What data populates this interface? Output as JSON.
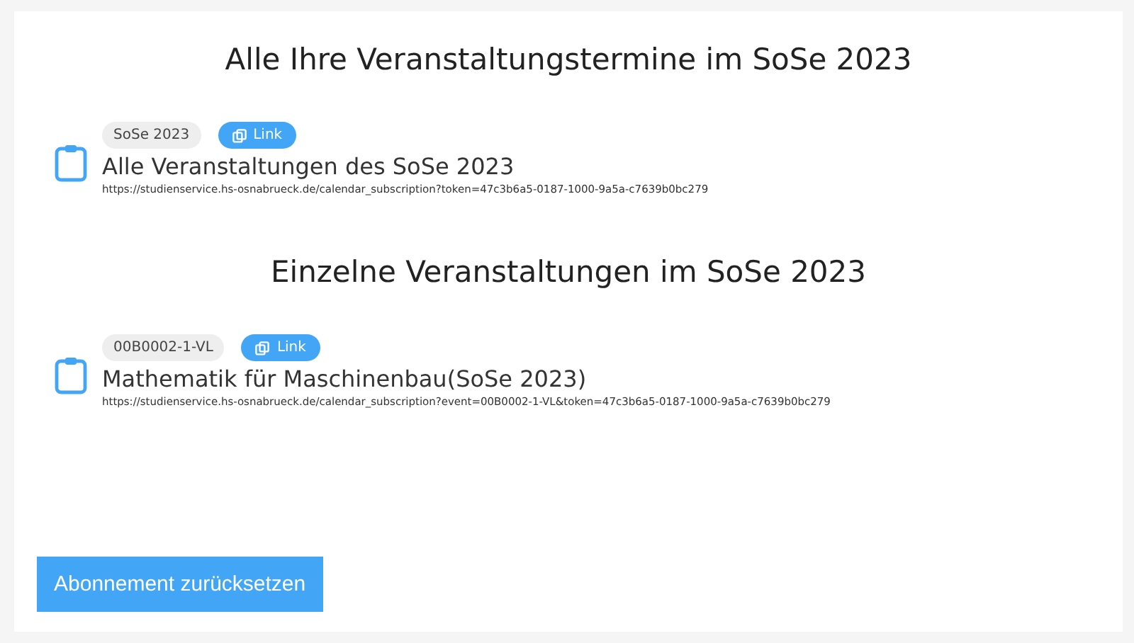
{
  "sections": [
    {
      "title": "Alle Ihre Veranstaltungstermine im SoSe 2023",
      "entries": [
        {
          "tag": "SoSe 2023",
          "link": "Link",
          "name": "Alle Veranstaltungen des SoSe 2023",
          "url": "https://studienservice.hs-osnabrueck.de/calendar_subscription?token=47c3b6a5-0187-1000-9a5a-c7639b0bc279"
        }
      ]
    },
    {
      "title": "Einzelne Veranstaltungen im SoSe 2023",
      "entries": [
        {
          "tag": "00B0002-1-VL",
          "link": "Link",
          "name": "Mathematik für Maschinenbau(SoSe 2023)",
          "url": "https://studienservice.hs-osnabrueck.de/calendar_subscription?event=00B0002-1-VL&token=47c3b6a5-0187-1000-9a5a-c7639b0bc279"
        }
      ]
    }
  ],
  "reset_button": "Abonnement zurücksetzen"
}
